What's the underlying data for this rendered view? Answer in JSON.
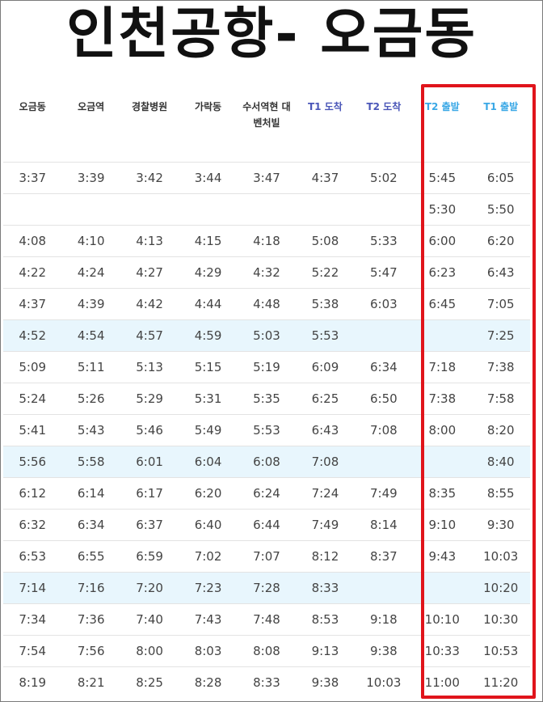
{
  "title": "인천공항- 오금동",
  "columns": [
    "오금동",
    "오금역",
    "경찰병원",
    "가락동",
    "수서역현 대벤처빌",
    "T1 도착",
    "T2 도착",
    "T2 출발",
    "T1 출발"
  ],
  "rows": [
    [
      "3:37",
      "3:39",
      "3:42",
      "3:44",
      "3:47",
      "4:37",
      "5:02",
      "5:45",
      "6:05"
    ],
    [
      "",
      "",
      "",
      "",
      "",
      "",
      "",
      "5:30",
      "5:50"
    ],
    [
      "4:08",
      "4:10",
      "4:13",
      "4:15",
      "4:18",
      "5:08",
      "5:33",
      "6:00",
      "6:20"
    ],
    [
      "4:22",
      "4:24",
      "4:27",
      "4:29",
      "4:32",
      "5:22",
      "5:47",
      "6:23",
      "6:43"
    ],
    [
      "4:37",
      "4:39",
      "4:42",
      "4:44",
      "4:48",
      "5:38",
      "6:03",
      "6:45",
      "7:05"
    ],
    [
      "4:52",
      "4:54",
      "4:57",
      "4:59",
      "5:03",
      "5:53",
      "",
      "",
      "7:25"
    ],
    [
      "5:09",
      "5:11",
      "5:13",
      "5:15",
      "5:19",
      "6:09",
      "6:34",
      "7:18",
      "7:38"
    ],
    [
      "5:24",
      "5:26",
      "5:29",
      "5:31",
      "5:35",
      "6:25",
      "6:50",
      "7:38",
      "7:58"
    ],
    [
      "5:41",
      "5:43",
      "5:46",
      "5:49",
      "5:53",
      "6:43",
      "7:08",
      "8:00",
      "8:20"
    ],
    [
      "5:56",
      "5:58",
      "6:01",
      "6:04",
      "6:08",
      "7:08",
      "",
      "",
      "8:40"
    ],
    [
      "6:12",
      "6:14",
      "6:17",
      "6:20",
      "6:24",
      "7:24",
      "7:49",
      "8:35",
      "8:55"
    ],
    [
      "6:32",
      "6:34",
      "6:37",
      "6:40",
      "6:44",
      "7:49",
      "8:14",
      "9:10",
      "9:30"
    ],
    [
      "6:53",
      "6:55",
      "6:59",
      "7:02",
      "7:07",
      "8:12",
      "8:37",
      "9:43",
      "10:03"
    ],
    [
      "7:14",
      "7:16",
      "7:20",
      "7:23",
      "7:28",
      "8:33",
      "",
      "",
      "10:20"
    ],
    [
      "7:34",
      "7:36",
      "7:40",
      "7:43",
      "7:48",
      "8:53",
      "9:18",
      "10:10",
      "10:30"
    ],
    [
      "7:54",
      "7:56",
      "8:00",
      "8:03",
      "8:08",
      "9:13",
      "9:38",
      "10:33",
      "10:53"
    ],
    [
      "8:19",
      "8:21",
      "8:25",
      "8:28",
      "8:33",
      "9:38",
      "10:03",
      "11:00",
      "11:20"
    ]
  ],
  "highlighted_rows": [
    5,
    9,
    13
  ],
  "colors": {
    "arrival_header": "#4a56b8",
    "departure_header": "#3aa8e6",
    "highlight_row": "#e8f6fd",
    "callout_box": "#e0141b"
  }
}
